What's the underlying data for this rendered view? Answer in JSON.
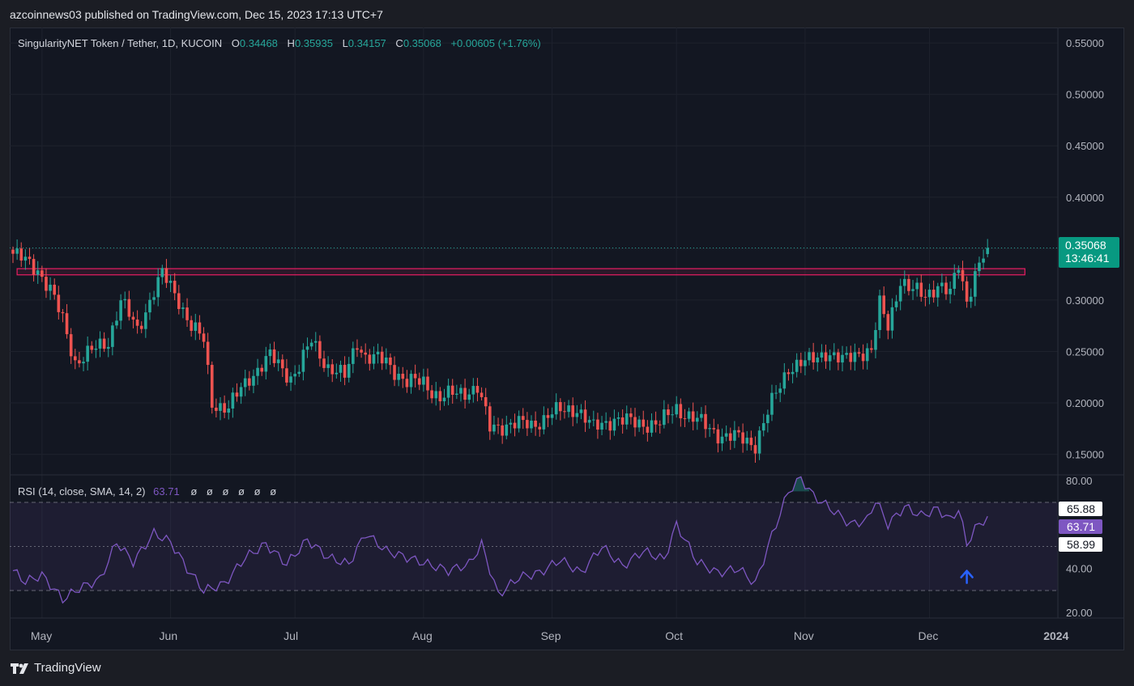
{
  "publisher_line": "azcoinnews03 published on TradingView.com, Dec 15, 2023 17:13 UTC+7",
  "brand": {
    "name": "TradingView",
    "logo_icon": "tradingview-logo-icon"
  },
  "legend": {
    "symbol": "SingularityNET Token / Tether, 1D, KUCOIN",
    "open_label": "O",
    "open": "0.34468",
    "high_label": "H",
    "high": "0.35935",
    "low_label": "L",
    "low": "0.34157",
    "close_label": "C",
    "close": "0.35068",
    "change": "+0.00605 (+1.76%)"
  },
  "price_tag": {
    "price": "0.35068",
    "countdown": "13:46:41"
  },
  "rsi_legend": {
    "label": "RSI (14, close, SMA, 14, 2)",
    "value": "63.71",
    "na": [
      "ø",
      "ø",
      "ø",
      "ø",
      "ø",
      "ø"
    ]
  },
  "rsi_tags": {
    "upper": "65.88",
    "value": "63.71",
    "lower": "58.99"
  },
  "colors": {
    "background": "#131722",
    "up": "#26a69a",
    "down": "#ef5350",
    "rsi": "#7e57c2",
    "resistance_zone": "#e91e63",
    "arrow": "#2962ff",
    "grid": "#1e222d",
    "axis_text": "#b2b5be"
  },
  "chart_data": [
    {
      "type": "candlestick",
      "title": "SingularityNET Token / Tether, 1D, KUCOIN",
      "x_tick_labels": [
        "May",
        "Jun",
        "Jul",
        "Aug",
        "Sep",
        "Oct",
        "Nov",
        "Dec",
        "2024"
      ],
      "y_tick_labels": [
        "0.55000",
        "0.50000",
        "0.45000",
        "0.40000",
        "0.35000",
        "0.30000",
        "0.25000",
        "0.20000",
        "0.15000"
      ],
      "ylim": [
        0.13,
        0.565
      ],
      "grid": true,
      "last_price": 0.35068,
      "resistance_zone": {
        "from": 0.3245,
        "to": 0.3305,
        "start": "2023-04-25",
        "end": "2023-12-24"
      },
      "anchors": [
        [
          "2023-04-24",
          0.345
        ],
        [
          "2023-04-30",
          0.33
        ],
        [
          "2023-05-03",
          0.31
        ],
        [
          "2023-05-06",
          0.28
        ],
        [
          "2023-05-09",
          0.24
        ],
        [
          "2023-05-13",
          0.25
        ],
        [
          "2023-05-17",
          0.26
        ],
        [
          "2023-05-20",
          0.3
        ],
        [
          "2023-05-24",
          0.27
        ],
        [
          "2023-05-28",
          0.31
        ],
        [
          "2023-05-30",
          0.325
        ],
        [
          "2023-06-03",
          0.3
        ],
        [
          "2023-06-06",
          0.275
        ],
        [
          "2023-06-09",
          0.26
        ],
        [
          "2023-06-11",
          0.2
        ],
        [
          "2023-06-15",
          0.195
        ],
        [
          "2023-06-20",
          0.225
        ],
        [
          "2023-06-25",
          0.245
        ],
        [
          "2023-06-30",
          0.225
        ],
        [
          "2023-07-02",
          0.235
        ],
        [
          "2023-07-05",
          0.26
        ],
        [
          "2023-07-09",
          0.235
        ],
        [
          "2023-07-13",
          0.225
        ],
        [
          "2023-07-16",
          0.26
        ],
        [
          "2023-07-18",
          0.245
        ],
        [
          "2023-07-23",
          0.24
        ],
        [
          "2023-07-28",
          0.22
        ],
        [
          "2023-08-01",
          0.22
        ],
        [
          "2023-08-05",
          0.205
        ],
        [
          "2023-08-10",
          0.21
        ],
        [
          "2023-08-14",
          0.215
        ],
        [
          "2023-08-17",
          0.175
        ],
        [
          "2023-08-22",
          0.18
        ],
        [
          "2023-08-27",
          0.178
        ],
        [
          "2023-09-01",
          0.19
        ],
        [
          "2023-09-07",
          0.195
        ],
        [
          "2023-09-11",
          0.175
        ],
        [
          "2023-09-16",
          0.185
        ],
        [
          "2023-09-21",
          0.18
        ],
        [
          "2023-09-27",
          0.18
        ],
        [
          "2023-10-01",
          0.195
        ],
        [
          "2023-10-07",
          0.18
        ],
        [
          "2023-10-12",
          0.168
        ],
        [
          "2023-10-17",
          0.165
        ],
        [
          "2023-10-20",
          0.16
        ],
        [
          "2023-10-24",
          0.2
        ],
        [
          "2023-10-28",
          0.235
        ],
        [
          "2023-11-02",
          0.24
        ],
        [
          "2023-11-06",
          0.25
        ],
        [
          "2023-11-10",
          0.24
        ],
        [
          "2023-11-14",
          0.25
        ],
        [
          "2023-11-17",
          0.25
        ],
        [
          "2023-11-19",
          0.295
        ],
        [
          "2023-11-21",
          0.275
        ],
        [
          "2023-11-24",
          0.32
        ],
        [
          "2023-11-26",
          0.31
        ],
        [
          "2023-11-30",
          0.305
        ],
        [
          "2023-12-03",
          0.315
        ],
        [
          "2023-12-06",
          0.305
        ],
        [
          "2023-12-08",
          0.335
        ],
        [
          "2023-12-10",
          0.3
        ],
        [
          "2023-12-12",
          0.325
        ],
        [
          "2023-12-15",
          0.35068
        ]
      ]
    },
    {
      "type": "line",
      "title": "RSI (14, close, SMA, 14, 2)",
      "y_tick_labels": [
        "80.00",
        "40.00",
        "20.00"
      ],
      "ylim": [
        17.5,
        82.5
      ],
      "bands": {
        "upper": 70,
        "middle": 50,
        "lower": 30
      },
      "last_value": 63.71,
      "series": [
        {
          "values": [
            [
              "2023-04-24",
              39
            ],
            [
              "2023-04-27",
              34
            ],
            [
              "2023-05-01",
              37
            ],
            [
              "2023-05-06",
              26
            ],
            [
              "2023-05-10",
              31
            ],
            [
              "2023-05-15",
              35
            ],
            [
              "2023-05-19",
              52
            ],
            [
              "2023-05-23",
              43
            ],
            [
              "2023-05-28",
              56
            ],
            [
              "2023-06-01",
              52
            ],
            [
              "2023-06-05",
              40
            ],
            [
              "2023-06-09",
              30
            ],
            [
              "2023-06-14",
              33
            ],
            [
              "2023-06-19",
              45
            ],
            [
              "2023-06-24",
              51
            ],
            [
              "2023-06-29",
              42
            ],
            [
              "2023-07-04",
              53
            ],
            [
              "2023-07-09",
              45
            ],
            [
              "2023-07-14",
              42
            ],
            [
              "2023-07-18",
              56
            ],
            [
              "2023-07-23",
              48
            ],
            [
              "2023-07-28",
              45
            ],
            [
              "2023-08-02",
              42
            ],
            [
              "2023-08-07",
              39
            ],
            [
              "2023-08-12",
              42
            ],
            [
              "2023-08-15",
              51
            ],
            [
              "2023-08-19",
              28
            ],
            [
              "2023-08-24",
              36
            ],
            [
              "2023-08-29",
              38
            ],
            [
              "2023-09-03",
              44
            ],
            [
              "2023-09-08",
              38
            ],
            [
              "2023-09-13",
              50
            ],
            [
              "2023-09-18",
              41
            ],
            [
              "2023-09-23",
              48
            ],
            [
              "2023-09-28",
              44
            ],
            [
              "2023-10-01",
              60
            ],
            [
              "2023-10-06",
              43
            ],
            [
              "2023-10-11",
              38
            ],
            [
              "2023-10-16",
              40
            ],
            [
              "2023-10-20",
              33
            ],
            [
              "2023-10-24",
              55
            ],
            [
              "2023-10-28",
              75
            ],
            [
              "2023-10-31",
              81
            ],
            [
              "2023-11-03",
              73
            ],
            [
              "2023-11-08",
              66
            ],
            [
              "2023-11-12",
              60
            ],
            [
              "2023-11-16",
              62
            ],
            [
              "2023-11-18",
              71
            ],
            [
              "2023-11-21",
              60
            ],
            [
              "2023-11-25",
              68
            ],
            [
              "2023-11-29",
              64
            ],
            [
              "2023-12-03",
              67
            ],
            [
              "2023-12-06",
              62
            ],
            [
              "2023-12-08",
              67
            ],
            [
              "2023-12-10",
              51
            ],
            [
              "2023-12-12",
              58
            ],
            [
              "2023-12-15",
              63.71
            ]
          ]
        }
      ]
    }
  ]
}
